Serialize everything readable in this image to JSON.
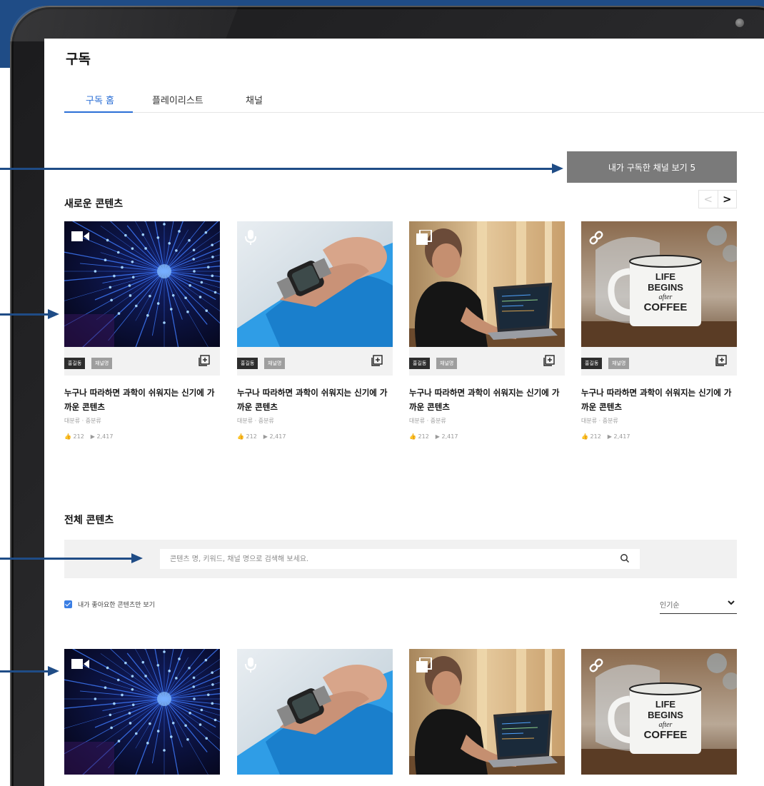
{
  "page": {
    "title": "구독"
  },
  "tabs": [
    {
      "label": "구독 홈",
      "active": true
    },
    {
      "label": "플레이리스트",
      "active": false
    },
    {
      "label": "채널",
      "active": false
    }
  ],
  "subscribed_button": {
    "label": "내가 구독한 채널 보기 5"
  },
  "new_section": {
    "title": "새로운 콘텐츠",
    "pager": {
      "prev": "<",
      "next": ">"
    },
    "cards": [
      {
        "type_icon": "video-camera-icon",
        "author": "홍길동",
        "channel": "채널명",
        "title": "누구나 따라하면 과학이 쉬워지는 신기에 가까운 콘텐츠",
        "category": "대분류 · 중분류",
        "likes": "212",
        "views": "2,417",
        "image": "network-lights"
      },
      {
        "type_icon": "microphone-icon",
        "author": "홍길동",
        "channel": "채널명",
        "title": "누구나 따라하면 과학이 쉬워지는 신기에 가까운 콘텐츠",
        "category": "대분류 · 중분류",
        "likes": "212",
        "views": "2,417",
        "image": "smartwatch-wrist"
      },
      {
        "type_icon": "document-stack-icon",
        "author": "홍길동",
        "channel": "채널명",
        "title": "누구나 따라하면 과학이 쉬워지는 신기에 가까운 콘텐츠",
        "category": "대분류 · 중분류",
        "likes": "212",
        "views": "2,417",
        "image": "man-laptop"
      },
      {
        "type_icon": "link-icon",
        "author": "홍길동",
        "channel": "채널명",
        "title": "누구나 따라하면 과학이 쉬워지는 신기에 가까운 콘텐츠",
        "category": "대분류 · 중분류",
        "likes": "212",
        "views": "2,417",
        "image": "coffee-mug"
      }
    ]
  },
  "all_section": {
    "title": "전체 콘텐츠",
    "search": {
      "placeholder": "콘텐츠 명, 키워드, 채널 명으로 검색해 보세요."
    },
    "filter": {
      "label": "내가 좋아요한 콘텐츠만 보기",
      "checked": true
    },
    "sort": {
      "value": "인기순"
    },
    "cards": [
      {
        "type_icon": "video-camera-icon",
        "image": "network-lights"
      },
      {
        "type_icon": "microphone-icon",
        "image": "smartwatch-wrist"
      },
      {
        "type_icon": "document-stack-icon",
        "image": "man-laptop"
      },
      {
        "type_icon": "link-icon",
        "image": "coffee-mug"
      }
    ]
  },
  "mug_text": {
    "line1": "LIFE",
    "line2": "BEGINS",
    "line3": "after",
    "line4": "COFFEE"
  },
  "colors": {
    "accent": "#2b6fd6",
    "annotation": "#1f4c86",
    "button": "#7a7a7a"
  }
}
